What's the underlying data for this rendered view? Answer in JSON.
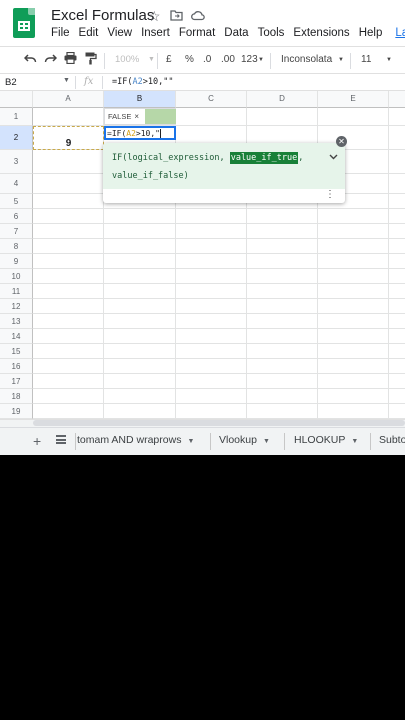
{
  "app": {
    "title": "Excel Formulas",
    "menu": [
      "File",
      "Edit",
      "View",
      "Insert",
      "Format",
      "Data",
      "Tools",
      "Extensions",
      "Help"
    ],
    "last_edit": "Last ed"
  },
  "toolbar": {
    "zoom": "100%",
    "currency": "£",
    "percent": "%",
    "decrease_decimal": ".0",
    "increase_decimal": ".00",
    "more_formats": "123",
    "font": "Inconsolata",
    "font_size": "11"
  },
  "formula_bar": {
    "cell_ref": "B2",
    "fx": "fx",
    "formula_prefix": "=IF(",
    "formula_ref": "A2",
    "formula_suffix": ">10,\"\""
  },
  "grid": {
    "columns": [
      "A",
      "B",
      "C",
      "D",
      "E"
    ],
    "rows": [
      "1",
      "2",
      "3",
      "4",
      "5",
      "6",
      "7",
      "8",
      "9",
      "10",
      "11",
      "12",
      "13",
      "14",
      "15",
      "16",
      "17",
      "18",
      "19"
    ],
    "cell_a2": "9",
    "cell_b2_prefix": "=IF(",
    "cell_b2_ref": "A2",
    "cell_b2_suffix": ">10,\""
  },
  "preview_chip": {
    "value": "FALSE",
    "close": "×"
  },
  "tooltip": {
    "sig_start": "IF(logical_expression, ",
    "sig_highlight": "value_if_true",
    "sig_end": ",",
    "sig_line2": "value_if_false)"
  },
  "sheet_tabs": [
    "tomam AND wraprows",
    "Vlookup",
    "HLOOKUP",
    "Subto"
  ],
  "colors": {
    "accent": "#1a73e8",
    "sheets_green": "#0f9d58",
    "tooltip_bg": "#e6f4ea",
    "tooltip_highlight": "#188038"
  }
}
